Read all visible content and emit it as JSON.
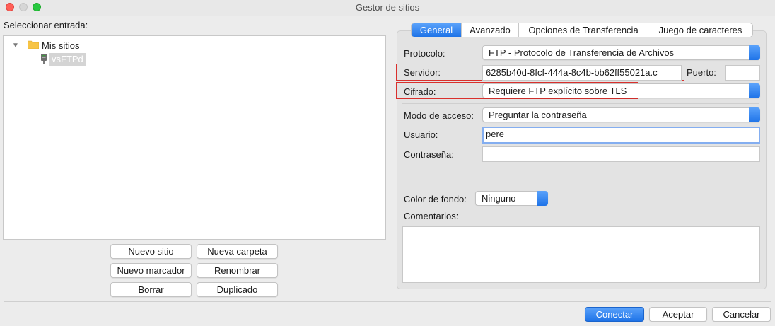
{
  "window": {
    "title": "Gestor de sitios"
  },
  "left": {
    "select_label": "Seleccionar entrada:",
    "tree": {
      "folder": "Mis sitios",
      "site": "vsFTPd"
    },
    "buttons": {
      "new_site": "Nuevo sitio",
      "new_folder": "Nueva carpeta",
      "new_bookmark": "Nuevo marcador",
      "rename": "Renombrar",
      "delete": "Borrar",
      "duplicate": "Duplicado"
    }
  },
  "tabs": [
    {
      "label": "General",
      "active": true
    },
    {
      "label": "Avanzado"
    },
    {
      "label": "Opciones de Transferencia"
    },
    {
      "label": "Juego de caracteres"
    }
  ],
  "form": {
    "protocol_label": "Protocolo:",
    "protocol_value": "FTP - Protocolo de Transferencia de Archivos",
    "server_label": "Servidor:",
    "server_value": "6285b40d-8fcf-444a-8c4b-bb62ff55021a.c",
    "port_label": "Puerto:",
    "port_value": "",
    "encryption_label": "Cifrado:",
    "encryption_value": "Requiere FTP explícito sobre TLS",
    "access_label": "Modo de acceso:",
    "access_value": "Preguntar la contraseña",
    "user_label": "Usuario:",
    "user_value": "pere",
    "password_label": "Contraseña:",
    "password_value": "",
    "bgcolor_label": "Color de fondo:",
    "bgcolor_value": "Ninguno",
    "comments_label": "Comentarios:",
    "comments_value": ""
  },
  "footer": {
    "connect": "Conectar",
    "accept": "Aceptar",
    "cancel": "Cancelar"
  },
  "colors": {
    "accent": "#1e73e8",
    "highlight": "#d9302d",
    "folder": "#f7c445"
  }
}
